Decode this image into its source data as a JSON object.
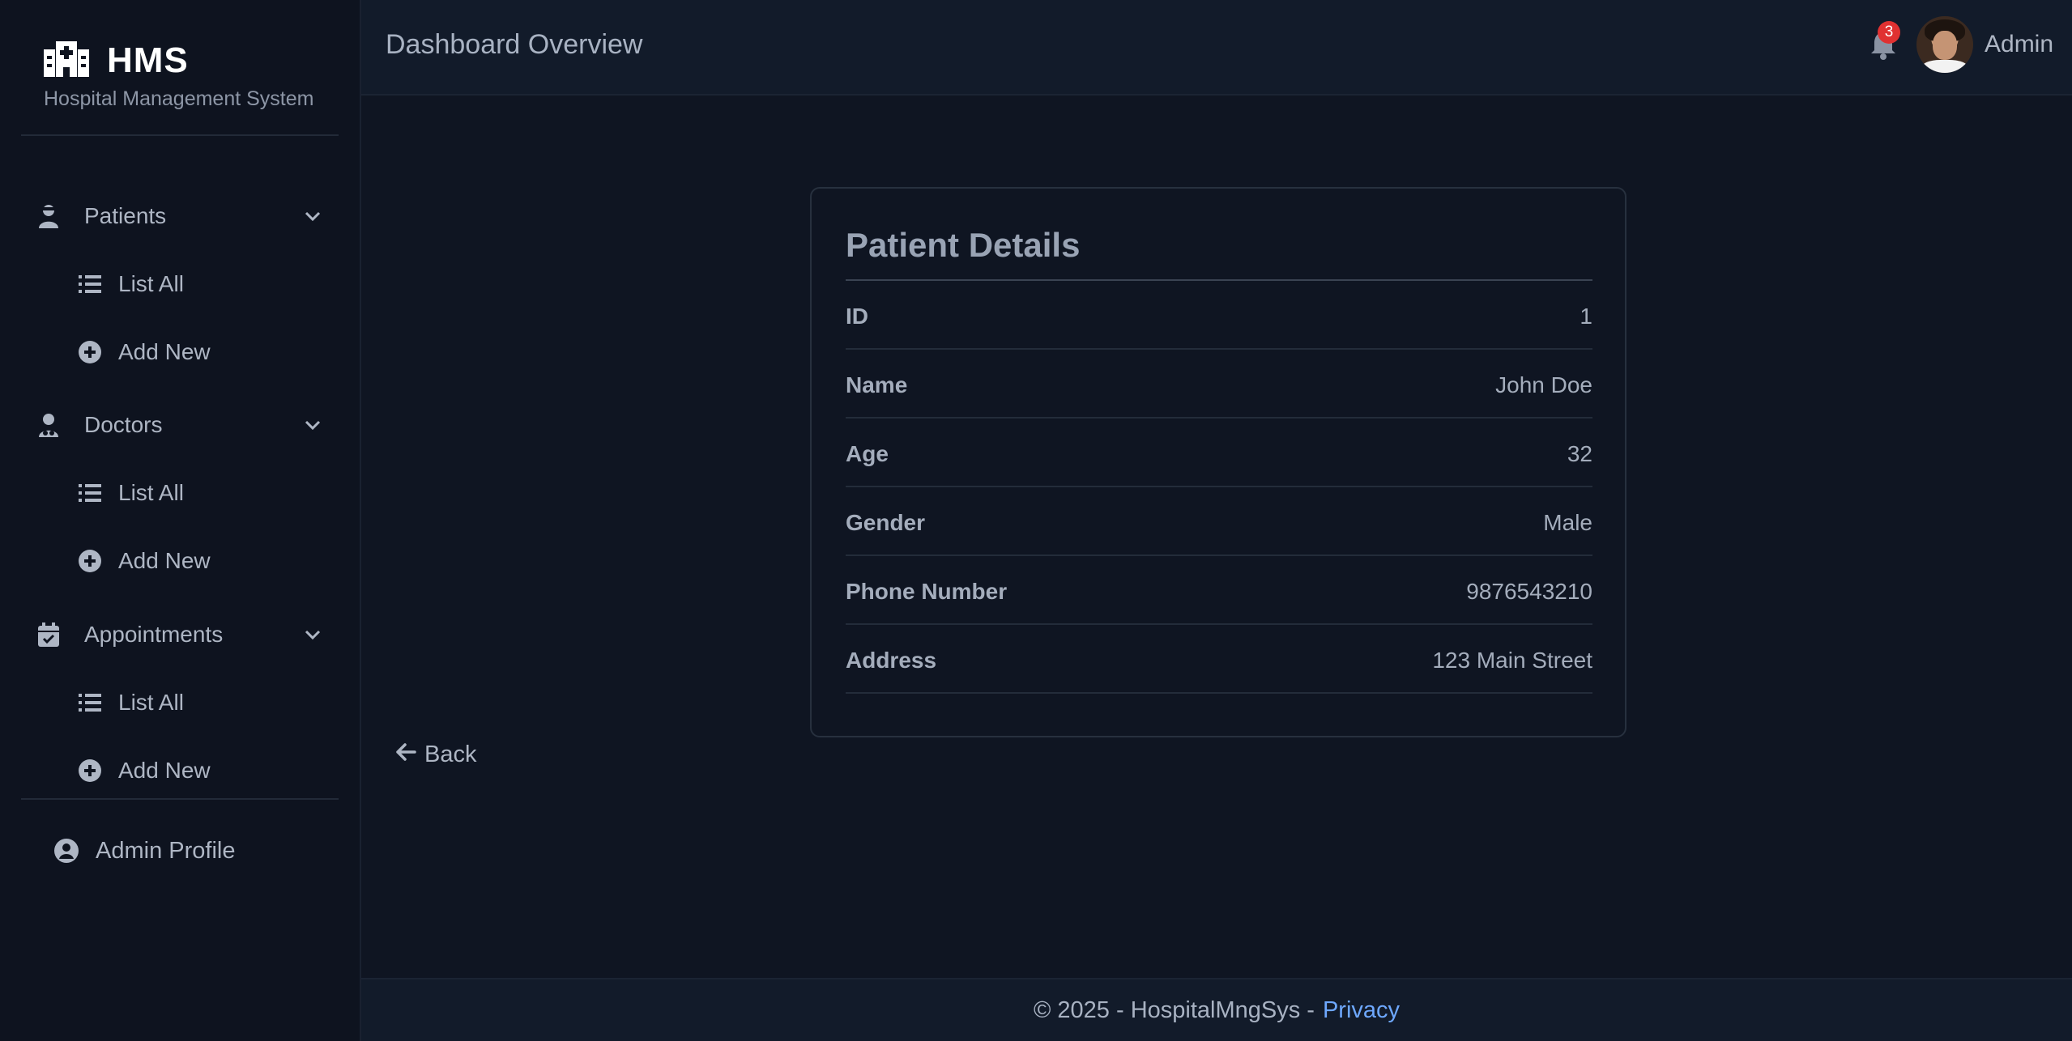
{
  "brand": {
    "name": "HMS",
    "subtitle": "Hospital Management System",
    "icon": "hospital-icon"
  },
  "sidebar": {
    "sections": [
      {
        "label": "Patients",
        "icon": "patient-user-icon",
        "items": [
          {
            "label": "List All",
            "icon": "list-icon"
          },
          {
            "label": "Add New",
            "icon": "plus-circle-icon"
          }
        ]
      },
      {
        "label": "Doctors",
        "icon": "doctor-user-icon",
        "items": [
          {
            "label": "List All",
            "icon": "list-icon"
          },
          {
            "label": "Add New",
            "icon": "plus-circle-icon"
          }
        ]
      },
      {
        "label": "Appointments",
        "icon": "calendar-check-icon",
        "items": [
          {
            "label": "List All",
            "icon": "list-icon"
          },
          {
            "label": "Add New",
            "icon": "plus-circle-icon"
          }
        ]
      }
    ],
    "profile": {
      "label": "Admin Profile",
      "icon": "user-circle-icon"
    }
  },
  "header": {
    "title": "Dashboard Overview",
    "notifications_count": "3",
    "user_name": "Admin"
  },
  "patient": {
    "title": "Patient Details",
    "fields": [
      {
        "key": "ID",
        "value": "1"
      },
      {
        "key": "Name",
        "value": "John Doe"
      },
      {
        "key": "Age",
        "value": "32"
      },
      {
        "key": "Gender",
        "value": "Male"
      },
      {
        "key": "Phone Number",
        "value": "9876543210"
      },
      {
        "key": "Address",
        "value": "123 Main Street"
      }
    ]
  },
  "back_label": "Back",
  "footer": {
    "text": "© 2025 - HospitalMngSys -",
    "link": "Privacy"
  },
  "colors": {
    "background": "#0f1522",
    "sidebar": "#0e131f",
    "topbar": "#121b2a",
    "badge": "#e03131",
    "link": "#6ea8fe"
  }
}
